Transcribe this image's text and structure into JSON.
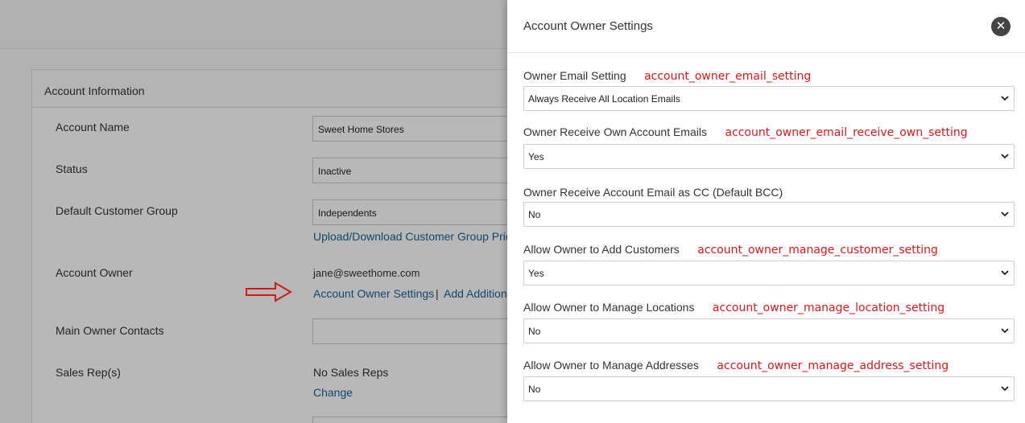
{
  "background": {
    "panel_title": "Account Information",
    "rows": {
      "account_name_label": "Account Name",
      "account_name_value": "Sweet Home Stores",
      "status_label": "Status",
      "status_value": "Inactive",
      "default_group_label": "Default Customer Group",
      "default_group_value": "Independents",
      "group_link": "Upload/Download Customer Group Pric",
      "account_owner_label": "Account Owner",
      "account_owner_email": "jane@sweethome.com",
      "owner_settings_link": "Account Owner Settings",
      "separator": "|",
      "add_additional_link": "Add Additiona",
      "main_owner_contacts_label": "Main Owner Contacts",
      "sales_reps_label": "Sales Rep(s)",
      "sales_reps_value": "No Sales Reps",
      "change_link": "Change"
    }
  },
  "drawer": {
    "title": "Account Owner Settings",
    "close_icon": "close-icon",
    "settings": [
      {
        "label": "Owner Email Setting",
        "key": "account_owner_email_setting",
        "value": "Always Receive All Location Emails"
      },
      {
        "label": "Owner Receive Own Account Emails",
        "key": "account_owner_email_receive_own_setting",
        "value": "Yes"
      },
      {
        "label": "Owner Receive Account Email as CC (Default BCC)",
        "key": "account_owner_email_receive_as_cc_setting",
        "value": "No"
      },
      {
        "label": "Allow Owner to Add Customers",
        "key": "account_owner_manage_customer_setting",
        "value": "Yes"
      },
      {
        "label": "Allow Owner to Manage Locations",
        "key": "account_owner_manage_location_setting",
        "value": "No"
      },
      {
        "label": "Allow Owner to Manage Addresses",
        "key": "account_owner_manage_address_setting",
        "value": "No"
      }
    ]
  },
  "colors": {
    "annotation_red": "#d01a1a",
    "link_blue": "#1a6496"
  }
}
